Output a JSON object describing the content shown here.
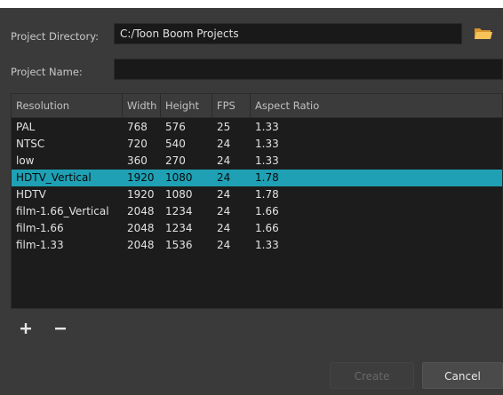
{
  "form": {
    "directory_label": "Project Directory:",
    "directory_value": "C:/Toon Boom Projects",
    "name_label": "Project Name:",
    "name_value": ""
  },
  "table": {
    "headers": [
      "Resolution",
      "Width",
      "Height",
      "FPS",
      "Aspect Ratio"
    ],
    "rows": [
      [
        "PAL",
        "768",
        "576",
        "25",
        "1.33"
      ],
      [
        "NTSC",
        "720",
        "540",
        "24",
        "1.33"
      ],
      [
        "low",
        "360",
        "270",
        "24",
        "1.33"
      ],
      [
        "HDTV_Vertical",
        "1920",
        "1080",
        "24",
        "1.78"
      ],
      [
        "HDTV",
        "1920",
        "1080",
        "24",
        "1.78"
      ],
      [
        "film-1.66_Vertical",
        "2048",
        "1234",
        "24",
        "1.66"
      ],
      [
        "film-1.66",
        "2048",
        "1234",
        "24",
        "1.66"
      ],
      [
        "film-1.33",
        "2048",
        "1536",
        "24",
        "1.33"
      ]
    ],
    "selected_row": "HDTV_Vertical"
  },
  "buttons": {
    "create": "Create",
    "cancel": "Cancel"
  },
  "colors": {
    "selection": "#1fa0b4",
    "folder_icon": "#f0b24a"
  },
  "icons": [
    "folder-icon",
    "plus-icon",
    "minus-icon"
  ]
}
